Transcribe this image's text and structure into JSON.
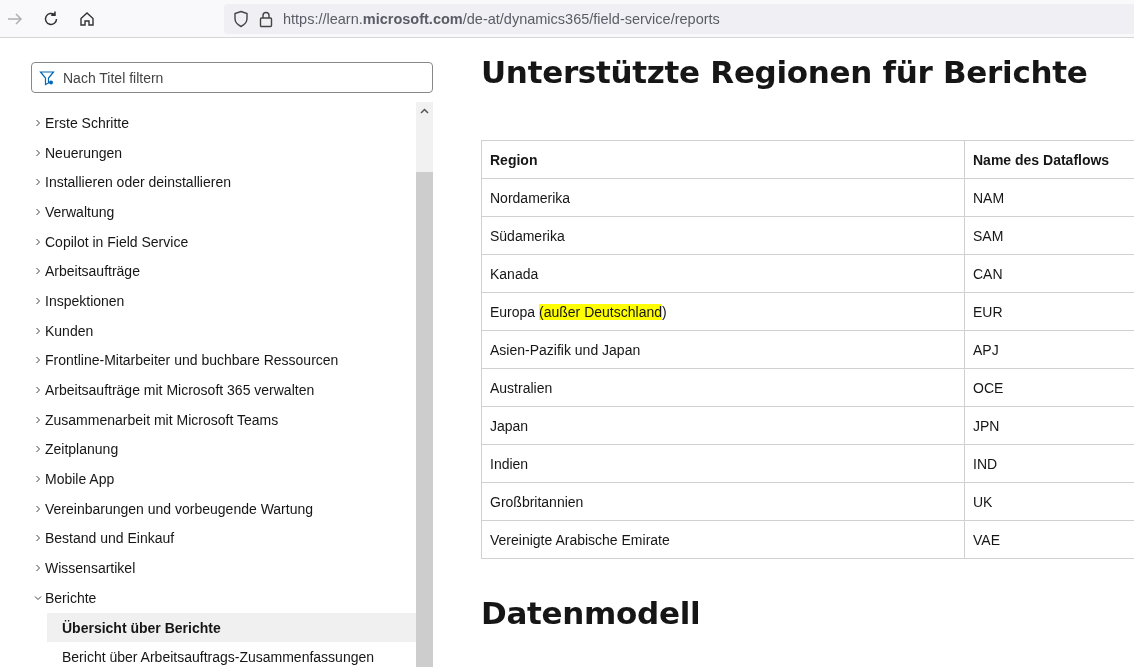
{
  "browser": {
    "url": "https://learn.**microsoft.com**/de-at/dynamics365/field-service/reports"
  },
  "sidebar": {
    "filter": {
      "placeholder": "Nach Titel filtern"
    },
    "items": [
      {
        "label": "Erste Schritte",
        "expanded": false
      },
      {
        "label": "Neuerungen",
        "expanded": false
      },
      {
        "label": "Installieren oder deinstallieren",
        "expanded": false
      },
      {
        "label": "Verwaltung",
        "expanded": false
      },
      {
        "label": "Copilot in Field Service",
        "expanded": false
      },
      {
        "label": "Arbeitsaufträge",
        "expanded": false
      },
      {
        "label": "Inspektionen",
        "expanded": false
      },
      {
        "label": "Kunden",
        "expanded": false
      },
      {
        "label": "Frontline-Mitarbeiter und buchbare Ressourcen",
        "expanded": false
      },
      {
        "label": "Arbeitsaufträge mit Microsoft 365 verwalten",
        "expanded": false
      },
      {
        "label": "Zusammenarbeit mit Microsoft Teams",
        "expanded": false
      },
      {
        "label": "Zeitplanung",
        "expanded": false
      },
      {
        "label": "Mobile App",
        "expanded": false
      },
      {
        "label": "Vereinbarungen und vorbeugende Wartung",
        "expanded": false
      },
      {
        "label": "Bestand und Einkauf",
        "expanded": false
      },
      {
        "label": "Wissensartikel",
        "expanded": false
      },
      {
        "label": "Berichte",
        "expanded": true,
        "children": [
          {
            "label": "Übersicht über Berichte",
            "selected": true
          },
          {
            "label": "Bericht über Arbeitsauftrags-Zusammenfassungen",
            "selected": false
          }
        ]
      }
    ]
  },
  "main": {
    "title": "Unterstützte Regionen für Berichte",
    "table": {
      "columns": [
        "Region",
        "Name des Dataflows"
      ],
      "rows": [
        [
          "Nordamerika",
          "NAM"
        ],
        [
          "Südamerika",
          "SAM"
        ],
        [
          "Kanada",
          "CAN"
        ],
        [
          "Europa *(außer Deutschland*)",
          "EUR"
        ],
        [
          "Asien-Pazifik und Japan",
          "APJ"
        ],
        [
          "Australien",
          "OCE"
        ],
        [
          "Japan",
          "JPN"
        ],
        [
          "Indien",
          "IND"
        ],
        [
          "Großbritannien",
          "UK"
        ],
        [
          "Vereinigte Arabische Emirate",
          "VAE"
        ]
      ]
    },
    "section_title": "Datenmodell"
  }
}
